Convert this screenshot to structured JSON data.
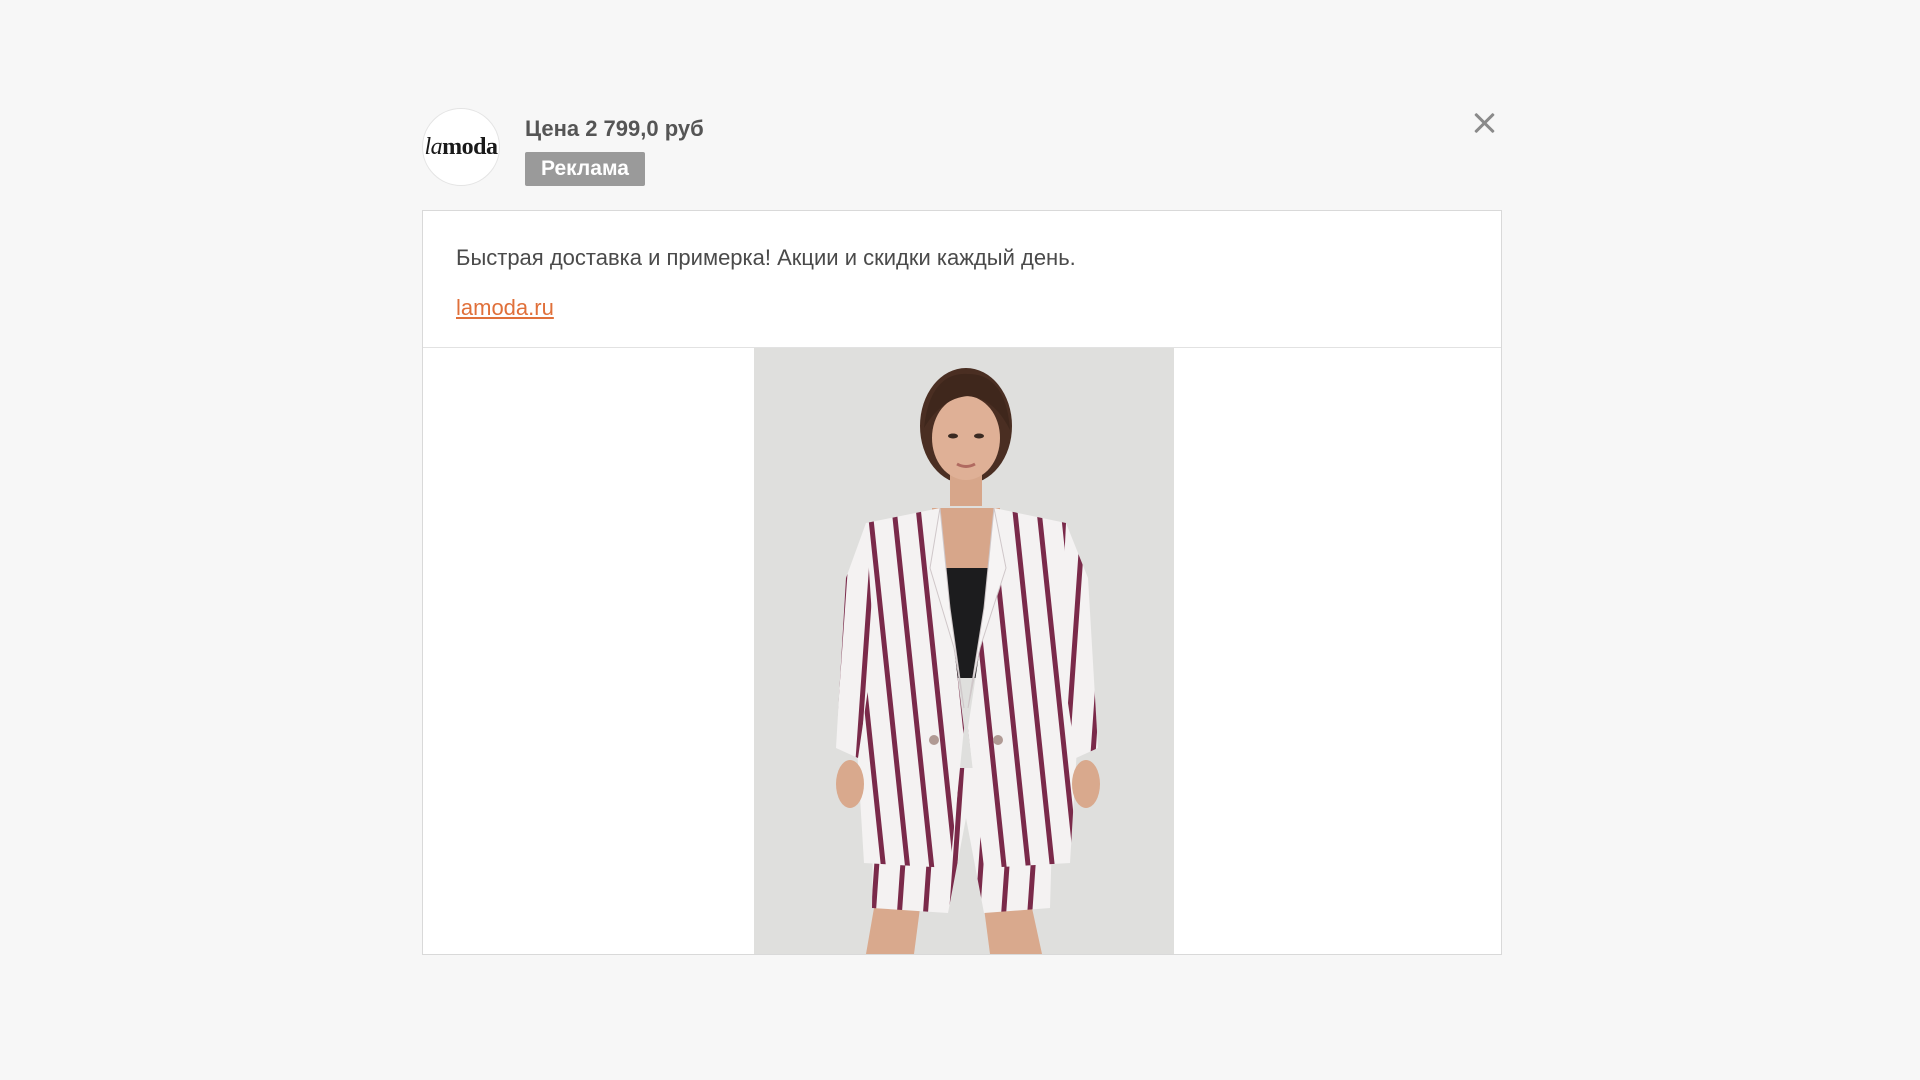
{
  "header": {
    "logo": {
      "prefix": "la",
      "suffix": "moda"
    },
    "price": "Цена 2 799,0 руб",
    "badge": "Реклама",
    "close_icon": "close-icon"
  },
  "card": {
    "description": "Быстрая доставка и примерка! Акции и скидки каждый день.",
    "link": "lamoda.ru",
    "image": {
      "icon": "product-photo",
      "alt": "Модель в полосатом жакете и шортах"
    }
  },
  "colors": {
    "page_background": "#f7f7f7",
    "badge_background": "#9a9a9a",
    "link": "#e0703a",
    "stripe": "#7a2a4a"
  }
}
